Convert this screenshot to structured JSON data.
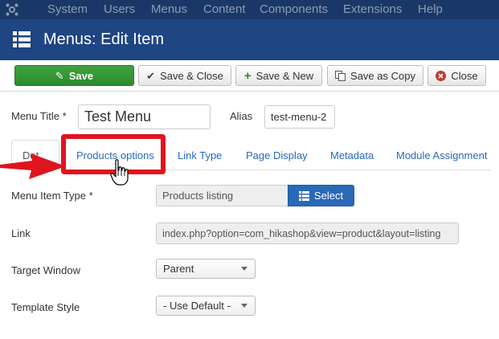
{
  "topnav": {
    "items": [
      "System",
      "Users",
      "Menus",
      "Content",
      "Components",
      "Extensions",
      "Help"
    ]
  },
  "header": {
    "title": "Menus: Edit Item"
  },
  "toolbar": {
    "save": "Save",
    "save_close": "Save & Close",
    "save_new": "Save & New",
    "save_copy": "Save as Copy",
    "close": "Close"
  },
  "form": {
    "menu_title_label": "Menu Title *",
    "menu_title_value": "Test Menu",
    "alias_label": "Alias",
    "alias_value": "test-menu-2"
  },
  "tabs": {
    "details_partial": "Det",
    "products_options": "Products options",
    "link_type": "Link Type",
    "page_display": "Page Display",
    "metadata": "Metadata",
    "module_assignment": "Module Assignment"
  },
  "fields": {
    "menu_item_type_label": "Menu Item Type *",
    "menu_item_type_value": "Products listing",
    "select_label": "Select",
    "link_label": "Link",
    "link_value": "index.php?option=com_hikashop&view=product&layout=listing",
    "target_window_label": "Target Window",
    "target_window_value": "Parent",
    "template_style_label": "Template Style",
    "template_style_value": "- Use Default -"
  },
  "colors": {
    "topnav_bg": "#1a3867",
    "header_bg": "#1f4582",
    "save_green": "#3fa33f",
    "highlight_red": "#e0141f",
    "link_blue": "#2a69b8"
  }
}
